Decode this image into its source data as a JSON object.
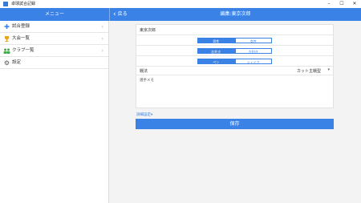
{
  "window": {
    "title": "卓球試合記録",
    "minimize": "–",
    "maximize": "☐",
    "close": "✕"
  },
  "header": {
    "menu_title": "メニュー",
    "back_label": "戻る",
    "edit_title": "編集:東京次郎"
  },
  "sidebar": {
    "items": [
      {
        "label": "試合登録",
        "icon": "plus-icon"
      },
      {
        "label": "大会一覧",
        "icon": "trophy-icon"
      },
      {
        "label": "クラブ一覧",
        "icon": "group-icon"
      },
      {
        "label": "設定",
        "icon": "gear-icon"
      }
    ]
  },
  "form": {
    "name": "東京次郎",
    "gender": {
      "options": [
        "男性",
        "女性"
      ],
      "selected": "男性"
    },
    "hand": {
      "options": [
        "右利き",
        "左利き"
      ],
      "selected": "右利き"
    },
    "grip": {
      "options": [
        "ペン",
        "シェイク"
      ],
      "selected": "ペン"
    },
    "style_label": "戦法",
    "style_value": "カット主戦型",
    "comment_placeholder": "選手メモ",
    "advanced_label": "詳細設定▾",
    "save_label": "保存"
  },
  "colors": {
    "accent": "#3a82e6",
    "trophy": "#e6a51c",
    "group": "#3cb043"
  }
}
